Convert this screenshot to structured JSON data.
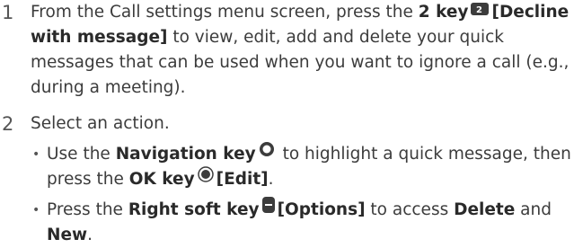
{
  "step1": {
    "number": "1",
    "text_a": "From the Call settings menu screen, press the ",
    "key_2_label": "2 key",
    "key_2_glyph": "2",
    "bracket": "[Decline with message]",
    "text_b": " to view, edit, add and delete your quick messages that can be used when you want to ignore a call (e.g., during a meeting)."
  },
  "step2": {
    "number": "2",
    "title": "Select an action.",
    "bullet1": {
      "t1": "Use the ",
      "nav_label": "Navigation key",
      "t2": " to highlight a quick message, then press the ",
      "ok_label": "OK key",
      "edit": "[Edit]",
      "t3": "."
    },
    "bullet2": {
      "t1": "Press the ",
      "rsk_label": "Right soft key",
      "options": "[Options]",
      "t2": " to access ",
      "delete": "Delete",
      "t3": " and ",
      "new": "New",
      "t4": "."
    }
  },
  "icons": {
    "key2": "number-2-key-icon",
    "nav": "navigation-key-icon",
    "ok": "ok-key-icon",
    "rsk": "right-soft-key-icon"
  }
}
